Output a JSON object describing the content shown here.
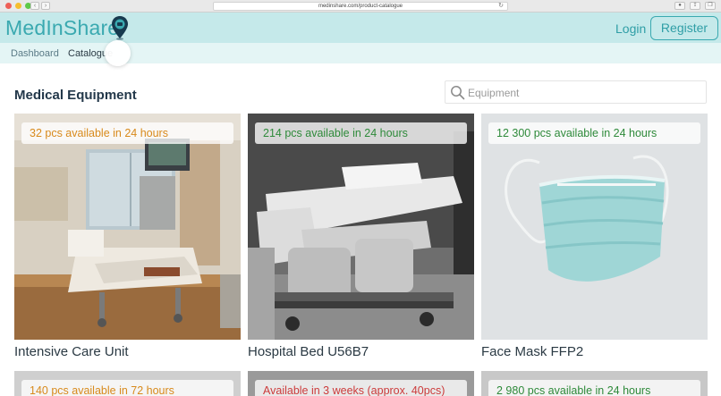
{
  "browser": {
    "url": "medinshare.com/product-catalogue"
  },
  "header": {
    "logo_text": "MedInShare",
    "login_label": "Login",
    "register_label": "Register"
  },
  "nav": {
    "dashboard_label": "Dashboard",
    "catalogue_label": "Catalogue"
  },
  "main": {
    "section_title": "Medical Equipment",
    "search": {
      "placeholder": "Equipment",
      "value": ""
    }
  },
  "products": [
    {
      "title": "Intensive Care Unit",
      "availability": "32 pcs available in 24 hours",
      "status_color": "#d88a1c"
    },
    {
      "title": "Hospital Bed U56B7",
      "availability": "214 pcs available in 24 hours",
      "status_color": "#2e8a3a"
    },
    {
      "title": "Face Mask FFP2",
      "availability": "12 300 pcs available in 24 hours",
      "status_color": "#2e8a3a"
    },
    {
      "title": "",
      "availability": "140 pcs available in 72 hours",
      "status_color": "#d88a1c"
    },
    {
      "title": "",
      "availability": "Available in 3 weeks (approx. 40pcs)",
      "status_color": "#cc3b3b"
    },
    {
      "title": "",
      "availability": "2 980 pcs available in 24 hours",
      "status_color": "#2e8a3a"
    }
  ],
  "colors": {
    "brand": "#3aa9b0",
    "header_bg": "#c5e9ea",
    "subnav_bg": "#e4f5f5"
  }
}
